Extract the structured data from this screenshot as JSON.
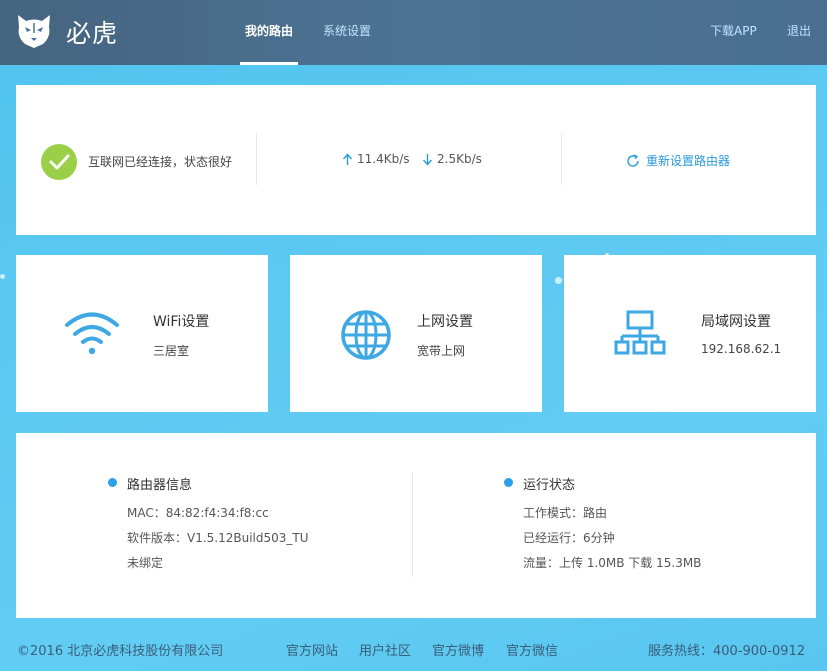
{
  "header": {
    "brand": "必虎",
    "tabs": [
      {
        "label": "我的路由",
        "active": true
      },
      {
        "label": "系统设置",
        "active": false
      }
    ],
    "download_app": "下载APP",
    "logout": "退出"
  },
  "status": {
    "connection_text": "互联网已经连接，状态很好",
    "upload_speed": "11.4Kb/s",
    "download_speed": "2.5Kb/s",
    "reconfigure_label": "重新设置路由器"
  },
  "cards": {
    "wifi": {
      "title": "WiFi设置",
      "subtitle": "三居室",
      "icon": "wifi-icon"
    },
    "internet": {
      "title": "上网设置",
      "subtitle": "宽带上网",
      "icon": "globe-icon"
    },
    "lan": {
      "title": "局域网设置",
      "subtitle": "192.168.62.1",
      "icon": "network-icon"
    }
  },
  "router_info": {
    "title": "路由器信息",
    "mac": "MAC：84:82:f4:34:f8:cc",
    "firmware": "软件版本：V1.5.12Build503_TU",
    "binding": "未绑定"
  },
  "running_status": {
    "title": "运行状态",
    "mode": "工作模式：路由",
    "uptime": "已经运行：6分钟",
    "traffic": "流量：上传 1.0MB 下载 15.3MB"
  },
  "footer": {
    "copyright": "©2016 北京必虎科技股份有限公司",
    "links": [
      "官方网站",
      "用户社区",
      "官方微博",
      "官方微信"
    ],
    "hotline": "服务热线：400-900-0912"
  },
  "colors": {
    "header_bg": "#4d7394",
    "page_bg": "#5cc9f2",
    "accent": "#2a9bd8",
    "success": "#9ccf48"
  }
}
